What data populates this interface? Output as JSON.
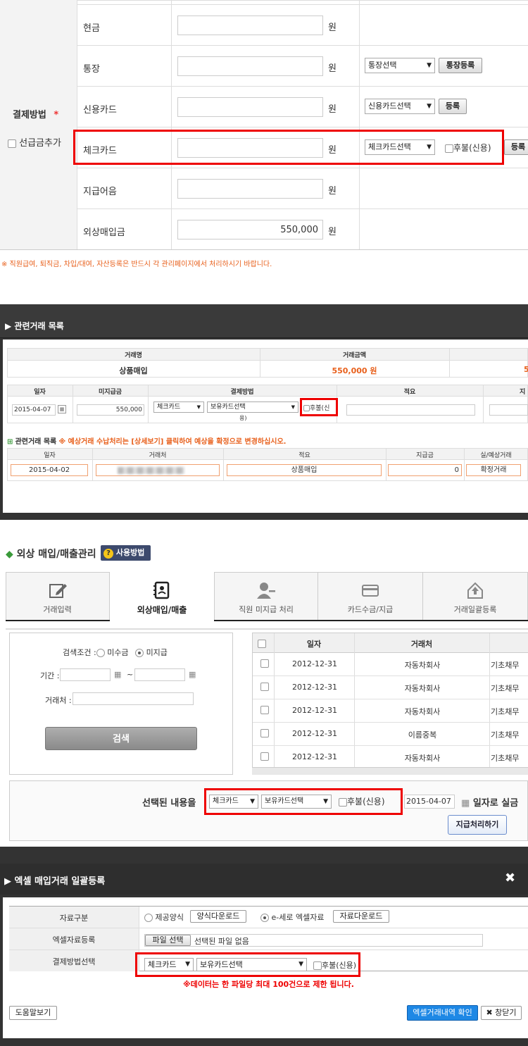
{
  "s1": {
    "side_label": "결제방법",
    "required_mark": "*",
    "prepay_label": "선급금추가",
    "rows": [
      {
        "label": "현금",
        "unit": "원"
      },
      {
        "label": "통장",
        "unit": "원"
      },
      {
        "label": "신용카드",
        "unit": "원"
      },
      {
        "label": "체크카드",
        "unit": "원"
      },
      {
        "label": "지급어음",
        "unit": "원"
      },
      {
        "label": "외상매입금",
        "unit": "원",
        "value": "550,000"
      }
    ],
    "bank_select": "통장선택",
    "bank_register": "통장등록",
    "credit_select": "신용카드선택",
    "credit_register": "등록",
    "check_select": "체크카드선택",
    "deferred": "후불(신용)",
    "check_register": "등록",
    "notice": "※ 직원급여, 퇴직금, 차입/대여, 자산등록은 반드시 각 관리페이지에서 처리하시기 바랍니다."
  },
  "s2": {
    "title": "▶ 관련거래 목록",
    "top_headers": [
      "거래명",
      "거래금액"
    ],
    "top_values": [
      "상품매입",
      "550,000 원",
      "5"
    ],
    "mid_headers": [
      "일자",
      "미지급금",
      "결제방법",
      "적요",
      "지"
    ],
    "date": "2015-04-07",
    "amount": "550,000",
    "pay_select": "체크카드",
    "card_select": "보유카드선택",
    "card_select2": "용)",
    "deferred": "후불(신",
    "sub_title": "관련거래 목록",
    "sub_notice": "※ 예상거래 수납처리는 [상세보기] 클릭하여 예상을 확정으로 변경하십시오.",
    "sub_headers": [
      "일자",
      "거래처",
      "적요",
      "지급금",
      "실/예상거래"
    ],
    "sub_row": [
      "2015-04-02",
      "",
      "상품매입",
      "0",
      "확정거래"
    ]
  },
  "s3": {
    "title": "외상 매입/매출관리",
    "help": "사용방법",
    "tabs": [
      {
        "label": "거래입력",
        "icon": "edit-icon"
      },
      {
        "label": "외상매입/매출",
        "icon": "ledger-icon"
      },
      {
        "label": "직원 미지급 처리",
        "icon": "user-minus-icon"
      },
      {
        "label": "카드수금/지급",
        "icon": "card-icon"
      },
      {
        "label": "거래일괄등록",
        "icon": "upload-icon"
      }
    ],
    "cond_label": "검색조건 :",
    "opt_unreceived": "미수금",
    "opt_unpaid": "미지급",
    "period_label": "기간 :",
    "tilde": "~",
    "client_label": "거래처 :",
    "search_button": "검색",
    "table_headers": [
      "일자",
      "거래처"
    ],
    "rows": [
      {
        "date": "2012-12-31",
        "client": "자동차회사",
        "extra": "기초채무"
      },
      {
        "date": "2012-12-31",
        "client": "자동차회사",
        "extra": "기초채무"
      },
      {
        "date": "2012-12-31",
        "client": "자동차회사",
        "extra": "기초채무"
      },
      {
        "date": "2012-12-31",
        "client": "이름중복",
        "extra": "기초채무"
      },
      {
        "date": "2012-12-31",
        "client": "자동차회사",
        "extra": "기초채무"
      }
    ],
    "selected_label": "선택된 내용을",
    "pay_select": "체크카드",
    "card_select": "보유카드선택",
    "deferred": "후불(신용)",
    "date": "2015-04-07",
    "date_suffix": "일자로 실금",
    "pay_button": "지급처리하기"
  },
  "s4": {
    "title": "▶ 엑셀 매입거래 일괄등록",
    "close": "✖",
    "row_labels": [
      "자료구분",
      "엑셀자료등록",
      "결제방법선택"
    ],
    "opt_provided": "제공양식",
    "dl_form": "양식다운로드",
    "opt_eseroh": "e-세로 엑셀자료",
    "dl_data": "자료다운로드",
    "file_button": "파일 선택",
    "file_none": "선택된 파일 없음",
    "pay_select": "체크카드",
    "card_select": "보유카드선택",
    "deferred": "후불(신용)",
    "limit_notice": "※데이터는 한 파일당 최대 100건으로 제한 됩니다.",
    "help_button": "도움말보기",
    "confirm_button": "엑셀거래내역 확인",
    "close_button": "창닫기"
  }
}
